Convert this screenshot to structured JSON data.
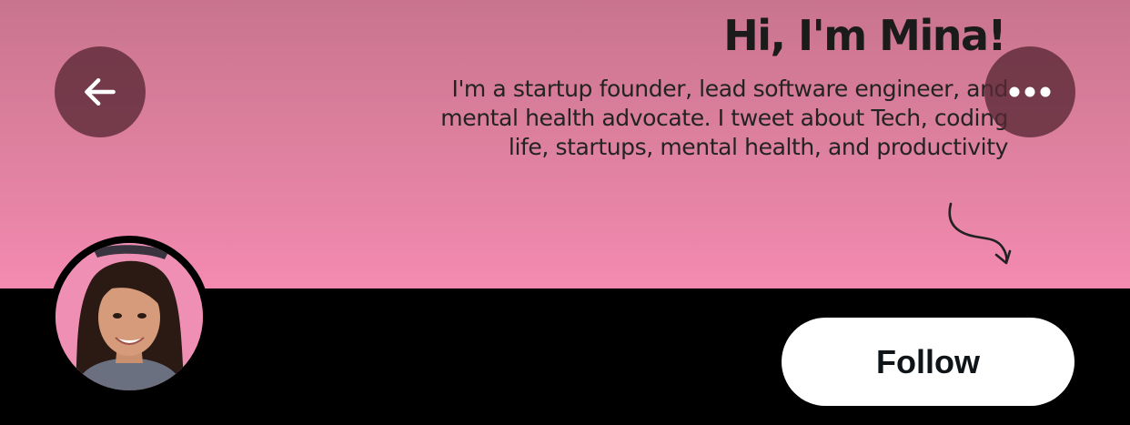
{
  "profile": {
    "headline": "Hi, I'm Mina!",
    "bio": "I'm a startup founder, lead software engineer, and mental health advocate. I tweet about Tech, coding life, startups, mental health, and productivity"
  },
  "header": {
    "back_icon": "arrow-left-icon",
    "more_icon": "more-horizontal-icon"
  },
  "actions": {
    "follow_label": "Follow"
  },
  "colors": {
    "banner_top": "#c9748f",
    "banner_bottom": "#f48ab0",
    "overlay_button": "#582834",
    "follow_button_bg": "#ffffff",
    "page_bg": "#000000"
  }
}
